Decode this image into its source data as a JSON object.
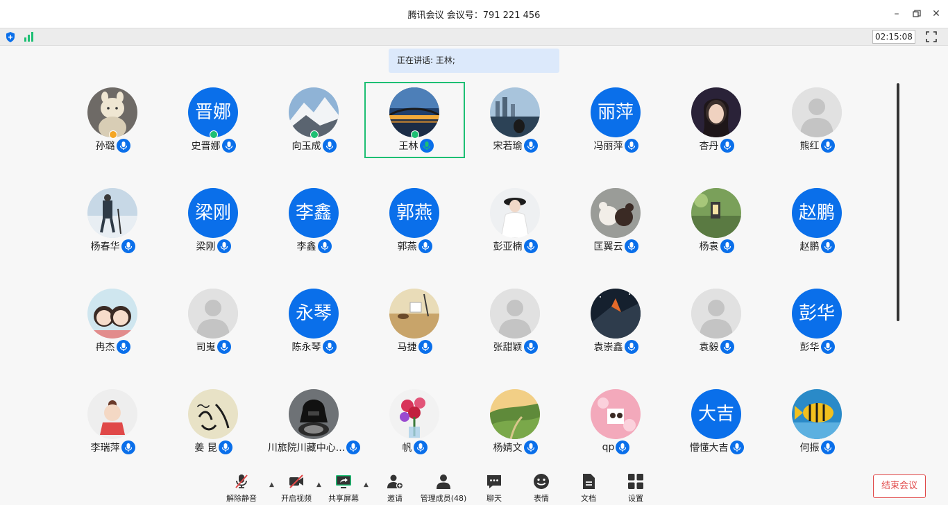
{
  "window": {
    "title": "腾讯会议 会议号：791 221 456",
    "minimize_icon": "minimize-icon",
    "restore_icon": "restore-icon",
    "close_icon": "close-icon"
  },
  "status": {
    "timer": "02:15:08",
    "colors": {
      "shield": "#0a6fea",
      "signal": "#1dbf73"
    }
  },
  "speaking_banner": "正在讲话: 王林;",
  "participants": [
    {
      "name": "孙璐",
      "avatar_type": "photo",
      "photo": "doll",
      "host": "orange"
    },
    {
      "name": "史晋娜",
      "avatar_type": "text",
      "text": "晋娜",
      "host": "green"
    },
    {
      "name": "向玉成",
      "avatar_type": "photo",
      "photo": "mountain",
      "host": "green"
    },
    {
      "name": "王林",
      "avatar_type": "photo",
      "photo": "bridge-sunset",
      "host": "green",
      "speaking": true,
      "active": true
    },
    {
      "name": "宋若瑜",
      "avatar_type": "photo",
      "photo": "city-harbor"
    },
    {
      "name": "冯丽萍",
      "avatar_type": "text",
      "text": "丽萍"
    },
    {
      "name": "杏丹",
      "avatar_type": "photo",
      "photo": "portrait-woman"
    },
    {
      "name": "熊红",
      "avatar_type": "default"
    },
    {
      "name": "杨春华",
      "avatar_type": "photo",
      "photo": "hiker"
    },
    {
      "name": "梁刚",
      "avatar_type": "text",
      "text": "梁刚"
    },
    {
      "name": "李鑫",
      "avatar_type": "text",
      "text": "李鑫"
    },
    {
      "name": "郭燕",
      "avatar_type": "text",
      "text": "郭燕"
    },
    {
      "name": "彭亚楠",
      "avatar_type": "photo",
      "photo": "girl-hat"
    },
    {
      "name": "匡翼云",
      "avatar_type": "photo",
      "photo": "toy-mice"
    },
    {
      "name": "杨袁",
      "avatar_type": "photo",
      "photo": "garden-lantern"
    },
    {
      "name": "赵鹏",
      "avatar_type": "text",
      "text": "赵鹏"
    },
    {
      "name": "冉杰",
      "avatar_type": "photo",
      "photo": "cartoon-couple"
    },
    {
      "name": "司嵬",
      "avatar_type": "default"
    },
    {
      "name": "陈永琴",
      "avatar_type": "text",
      "text": "永琴"
    },
    {
      "name": "马捷",
      "avatar_type": "photo",
      "photo": "tea-table"
    },
    {
      "name": "张甜颖",
      "avatar_type": "default"
    },
    {
      "name": "袁崇鑫",
      "avatar_type": "photo",
      "photo": "night-volcano"
    },
    {
      "name": "袁毅",
      "avatar_type": "default"
    },
    {
      "name": "彭华",
      "avatar_type": "text",
      "text": "彭华"
    },
    {
      "name": "李瑞萍",
      "avatar_type": "photo",
      "photo": "cartoon-girl"
    },
    {
      "name": "姜 昆",
      "avatar_type": "photo",
      "photo": "calligraphy"
    },
    {
      "name": "川旅院川藏中心...",
      "avatar_type": "photo",
      "photo": "darth-vader-bike"
    },
    {
      "name": "帆",
      "avatar_type": "photo",
      "photo": "flowers"
    },
    {
      "name": "杨婧文",
      "avatar_type": "photo",
      "photo": "green-valley"
    },
    {
      "name": "qp",
      "avatar_type": "photo",
      "photo": "pink-flowers"
    },
    {
      "name": "懵懂大吉",
      "avatar_type": "text",
      "text": "大吉"
    },
    {
      "name": "何振",
      "avatar_type": "photo",
      "photo": "tropical-fish"
    }
  ],
  "toolbar": {
    "unmute": "解除静音",
    "start_video": "开启视频",
    "share_screen": "共享屏幕",
    "invite": "邀请",
    "manage_members": "管理成员(48)",
    "chat": "聊天",
    "reactions": "表情",
    "docs": "文档",
    "settings": "设置",
    "end_meeting": "结束会议"
  }
}
